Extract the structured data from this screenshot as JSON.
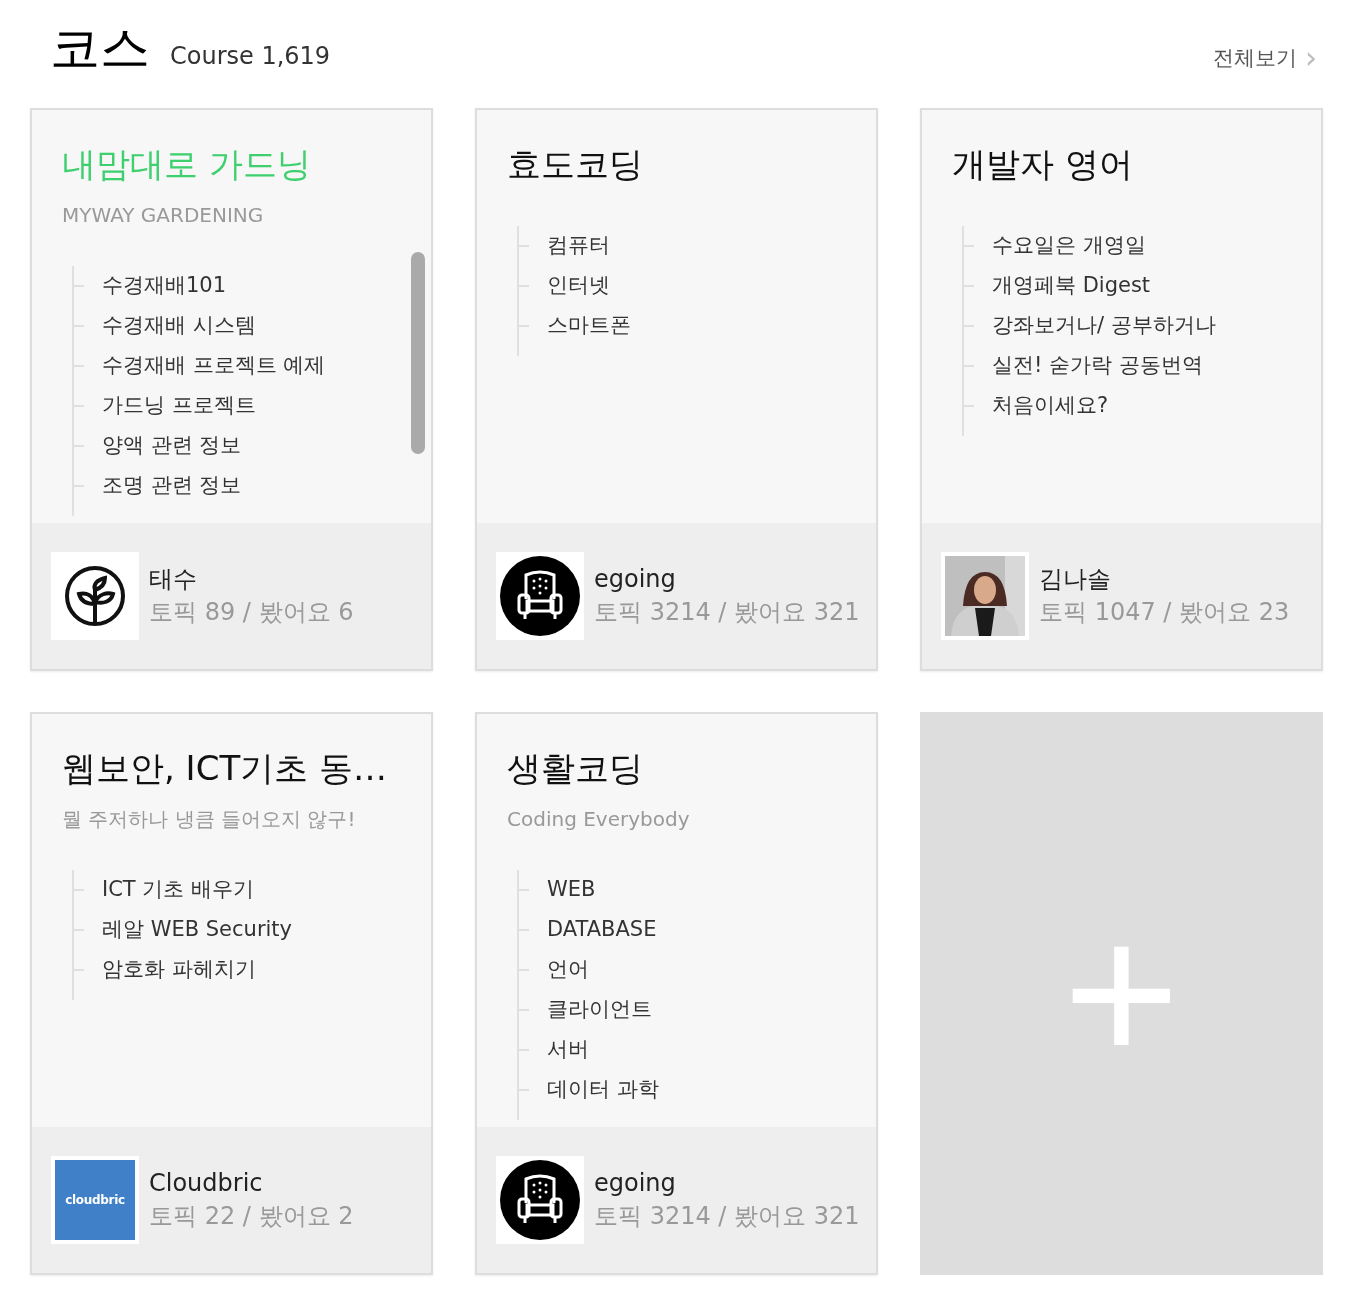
{
  "header": {
    "title": "코스",
    "subtitle": "Course 1,619",
    "view_all": "전체보기",
    "view_all_icon": "›"
  },
  "cards": [
    {
      "kind": "course",
      "title": "내맘대로 가드닝",
      "highlighted": true,
      "subtitle": "MYWAY GARDENING",
      "scrollbar": true,
      "topics": [
        "수경재배101",
        "수경재배 시스템",
        "수경재배 프로젝트 예제",
        "가드닝 프로젝트",
        "양액 관련 정보",
        "조명 관련 정보"
      ],
      "author": {
        "name": "태수",
        "stats": "토픽 89 / 봤어요 6",
        "avatar": {
          "kind": "plant"
        }
      }
    },
    {
      "kind": "course",
      "title": "효도코딩",
      "highlighted": false,
      "scrollbar": false,
      "topics": [
        "컴퓨터",
        "인터넷",
        "스마트폰"
      ],
      "author": {
        "name": "egoing",
        "stats": "토픽 3214 / 봤어요 321",
        "avatar": {
          "kind": "armchair"
        }
      }
    },
    {
      "kind": "course",
      "title": "개발자 영어",
      "highlighted": false,
      "scrollbar": false,
      "topics": [
        "수요일은 개영일",
        "개영페북 Digest",
        "강좌보거나/ 공부하거나",
        "실전! 숟가락 공동번역",
        "처음이세요?"
      ],
      "author": {
        "name": "김나솔",
        "stats": "토픽 1047 / 봤어요 23"
      }
    },
    {
      "kind": "course",
      "title": "웹보안, ICT기초 동…",
      "highlighted": false,
      "subtitle": "뭘 주저하나 냉큼 들어오지 않구!",
      "scrollbar": false,
      "topics": [
        "ICT 기초 배우기",
        "레알 WEB Security",
        "암호화 파헤치기"
      ],
      "author": {
        "name": "Cloudbric",
        "stats": "토픽 22 / 봤어요 2",
        "avatar": {
          "kind": "logo",
          "logo_text": "cloudbric"
        }
      }
    },
    {
      "kind": "course",
      "title": "생활코딩",
      "highlighted": false,
      "subtitle": "Coding Everybody",
      "scrollbar": false,
      "topics": [
        "WEB",
        "DATABASE",
        "언어",
        "클라이언트",
        "서버",
        "데이터 과학"
      ],
      "author": {
        "name": "egoing",
        "stats": "토픽 3214 / 봤어요 321",
        "avatar": {
          "kind": "armchair"
        }
      }
    },
    {
      "kind": "add",
      "symbol": "+"
    }
  ]
}
